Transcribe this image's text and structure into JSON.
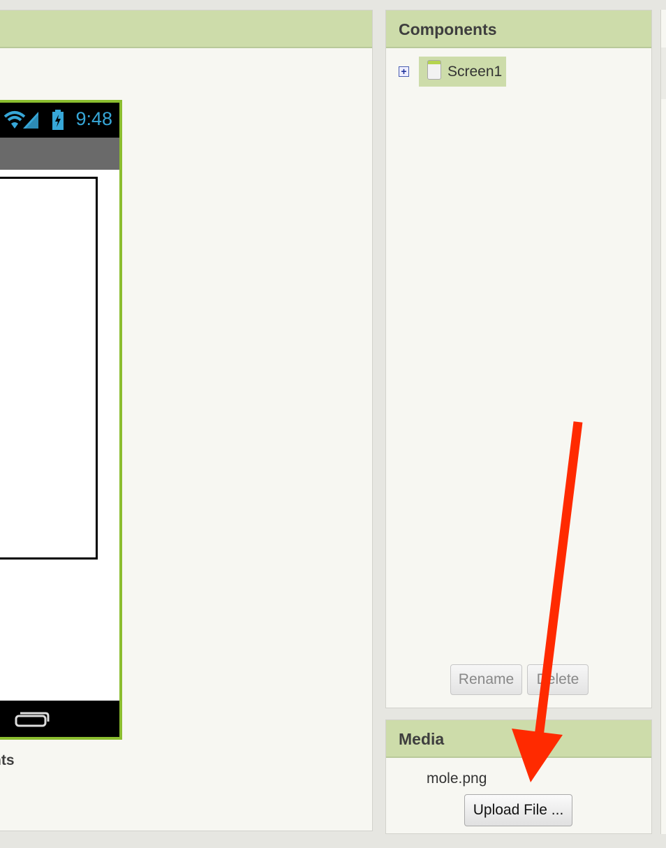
{
  "viewer": {
    "header_title": "",
    "status_time": "9:48",
    "nonvisible_label_fragment": "nts"
  },
  "components": {
    "header_title": "Components",
    "tree": [
      {
        "label": "Screen1",
        "icon": "screen-icon",
        "expanded": false,
        "selected": true
      }
    ],
    "rename_label": "Rename",
    "delete_label": "Delete"
  },
  "media": {
    "header_title": "Media",
    "files": [
      "mole.png"
    ],
    "upload_label": "Upload File ..."
  },
  "annotation": {
    "type": "arrow",
    "color": "#ff2a00"
  },
  "colors": {
    "header_bg": "#cddcaa",
    "phone_border": "#8bbd2f",
    "status_time": "#37a7d8"
  }
}
